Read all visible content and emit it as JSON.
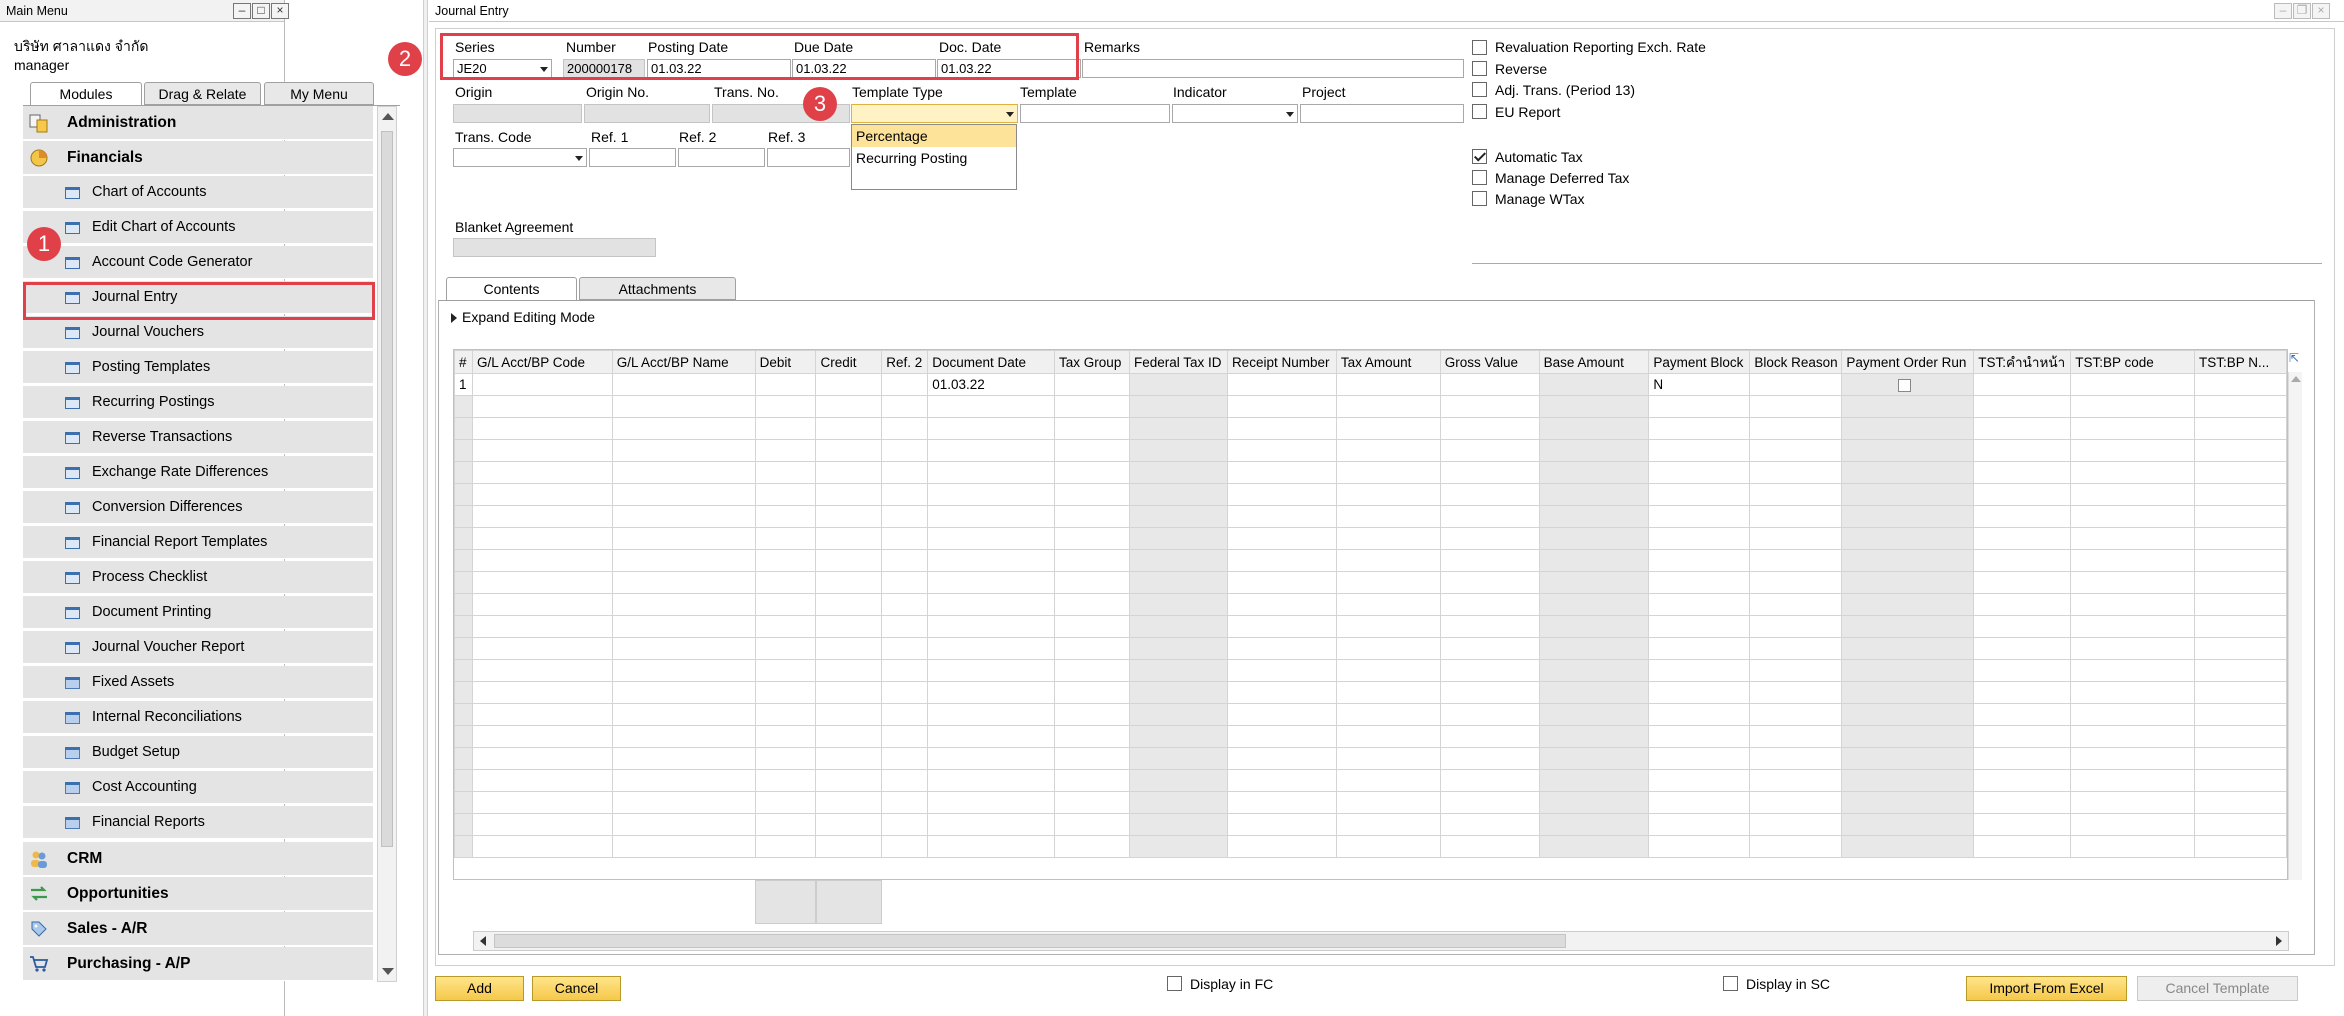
{
  "main_menu": {
    "title": "Main Menu",
    "company": "บริษัท ศาลาแดง จำกัด",
    "user": "manager",
    "tabs": [
      "Modules",
      "Drag & Relate",
      "My Menu"
    ],
    "modules": {
      "administration": "Administration",
      "financials": "Financials",
      "crm": "CRM",
      "opportunities": "Opportunities",
      "sales": "Sales - A/R",
      "purchasing": "Purchasing - A/P"
    },
    "financial_items": [
      "Chart of Accounts",
      "Edit Chart of Accounts",
      "Account Code Generator",
      "Journal Entry",
      "Journal Vouchers",
      "Posting Templates",
      "Recurring Postings",
      "Reverse Transactions",
      "Exchange Rate Differences",
      "Conversion Differences",
      "Financial Report Templates",
      "Process Checklist",
      "Document Printing",
      "Journal Voucher Report",
      "Fixed Assets",
      "Internal Reconciliations",
      "Budget Setup",
      "Cost Accounting",
      "Financial Reports"
    ]
  },
  "journal_entry": {
    "title": "Journal Entry",
    "labels": {
      "series": "Series",
      "number": "Number",
      "posting_date": "Posting Date",
      "due_date": "Due Date",
      "doc_date": "Doc. Date",
      "remarks": "Remarks",
      "origin": "Origin",
      "origin_no": "Origin No.",
      "trans_no": "Trans. No.",
      "template_type": "Template Type",
      "template": "Template",
      "indicator": "Indicator",
      "project": "Project",
      "trans_code": "Trans. Code",
      "ref1": "Ref. 1",
      "ref2": "Ref. 2",
      "ref3": "Ref. 3",
      "blanket_agreement": "Blanket Agreement"
    },
    "values": {
      "series": "JE20",
      "number": "200000178",
      "posting_date": "01.03.22",
      "due_date": "01.03.22",
      "doc_date": "01.03.22"
    },
    "template_options": [
      "Percentage",
      "Recurring Posting"
    ],
    "checkboxes": {
      "reval": "Revaluation Reporting Exch. Rate",
      "reverse": "Reverse",
      "adj": "Adj. Trans. (Period 13)",
      "eu": "EU Report",
      "autotax": "Automatic Tax",
      "deferred": "Manage Deferred Tax",
      "wtax": "Manage WTax"
    },
    "tabs": [
      "Contents",
      "Attachments"
    ],
    "expand": "Expand Editing Mode",
    "columns": [
      "#",
      "G/L Acct/BP Code",
      "G/L Acct/BP Name",
      "Debit",
      "Credit",
      "Ref. 2",
      "Document Date",
      "Tax Group",
      "Federal Tax ID",
      "Receipt Number",
      "Tax Amount",
      "Gross Value",
      "Base Amount",
      "Payment Block",
      "Block Reason",
      "Payment Order Run",
      "TST:คำนำหน้า",
      "TST:BP code",
      "TST:BP N..."
    ],
    "row1": {
      "num": "1",
      "doc_date": "01.03.22",
      "payment_block": "N"
    },
    "display_fc": "Display in FC",
    "display_sc": "Display in SC",
    "buttons": {
      "add": "Add",
      "cancel": "Cancel",
      "import": "Import From Excel",
      "cancel_template": "Cancel Template"
    }
  },
  "annotations": [
    "1",
    "2",
    "3"
  ]
}
